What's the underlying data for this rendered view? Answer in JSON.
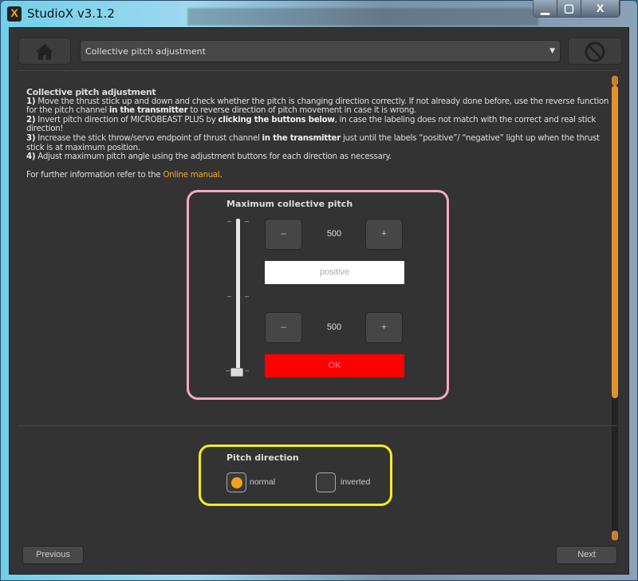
{
  "window": {
    "title": "StudioX v3.1.2",
    "app_icon_letter": "X",
    "controls": {
      "minimize": "▁",
      "maximize": "▢",
      "close": "X"
    }
  },
  "toolbar": {
    "home_icon": "home-icon",
    "dropdown_value": "Collective pitch adjustment",
    "right_icon": "no-sign-icon"
  },
  "instructions": {
    "heading": "Collective pitch adjustment",
    "s1_num": "1)",
    "s1_a": " Move the thrust stick up and down and check whether the pitch is changing direction correctly. If not already done before, use the reverse function for the pitch channel ",
    "s1_b": "in the transmitter",
    "s1_c": " to reverse direction of pitch movement in case it is wrong.",
    "s2_num": "2)",
    "s2_a": " Invert pitch direction of MICROBEAST PLUS by ",
    "s2_b": "clicking the buttons below",
    "s2_c": ", in case the labeling does not match with the correct and real stick direction!",
    "s3_num": "3)",
    "s3_a": " Increase the stick throw/servo endpoint of thrust channel ",
    "s3_b": "in the transmitter",
    "s3_c": " just until the labels “positive”/ “negative” light up when the thrust stick is at maximum position.",
    "s4_num": "4)",
    "s4_a": " Adjust maximum pitch angle using the adjustment buttons for each direction as necessary.",
    "further": "For further information refer to the ",
    "link": "Online manual",
    "period": "."
  },
  "max_pitch": {
    "title": "Maximum collective pitch",
    "positive_value": "500",
    "negative_value": "500",
    "minus": "–",
    "plus": "+",
    "positive_label": "positive",
    "ok_label": "OK",
    "stick_position_fraction": 0.0,
    "ok_color": "#ff0000",
    "highlight_color": "#f4a9c4"
  },
  "pitch_direction": {
    "title": "Pitch direction",
    "options": [
      {
        "label": "normal",
        "selected": true
      },
      {
        "label": "inverted",
        "selected": false
      }
    ],
    "accent": "#f5a11c",
    "highlight_color": "#f2ee1c"
  },
  "footer": {
    "previous": "Previous",
    "next": "Next"
  }
}
